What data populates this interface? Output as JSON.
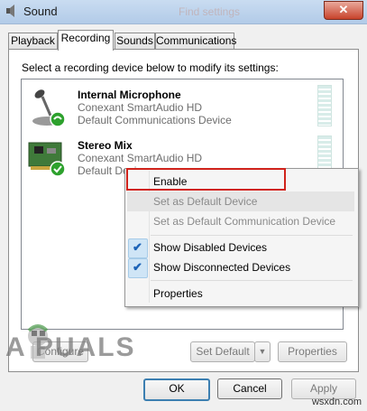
{
  "window": {
    "title": "Sound",
    "close_glyph": "✕",
    "ghost_title": "Find settings"
  },
  "tabs": [
    "Playback",
    "Recording",
    "Sounds",
    "Communications"
  ],
  "instruction": "Select a recording device below to modify its settings:",
  "devices": [
    {
      "name": "Internal Microphone",
      "driver": "Conexant SmartAudio HD",
      "status": "Default Communications Device",
      "icon": "microphone-icon"
    },
    {
      "name": "Stereo Mix",
      "driver": "Conexant SmartAudio HD",
      "status": "Default Device",
      "icon": "sound-card-icon"
    }
  ],
  "context_menu": {
    "items": [
      "Enable",
      "Set as Default Device",
      "Set as Default Communication Device",
      "Show Disabled Devices",
      "Show Disconnected Devices",
      "Properties"
    ],
    "check": "✔"
  },
  "buttons": {
    "configure": "Configure",
    "set_default": "Set Default",
    "dropdown_arrow": "▼",
    "properties": "Properties",
    "ok": "OK",
    "cancel": "Cancel",
    "apply": "Apply"
  },
  "watermark": "A  PUALS",
  "site": "wsxdn.com",
  "colors": {
    "highlight_box": "#d0231b",
    "check_blue": "#1c63b7",
    "green_badge": "#2da12d"
  }
}
